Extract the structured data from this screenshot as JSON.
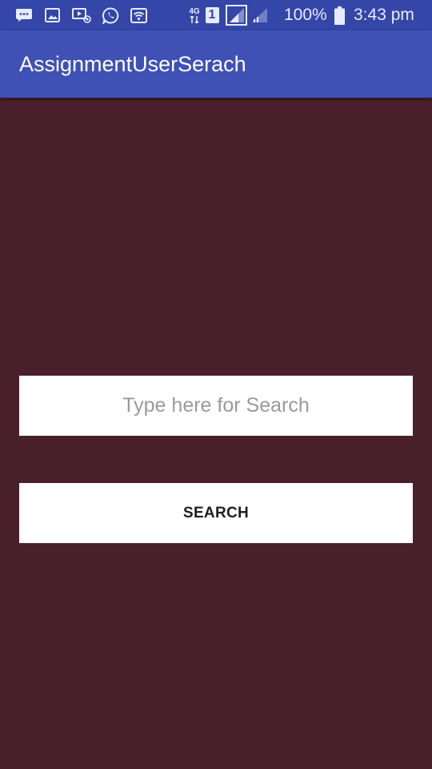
{
  "status_bar": {
    "network_type": "4G",
    "sim_slot": "1",
    "battery_percent": "100%",
    "time": "3:43 pm",
    "icons": [
      "messenger-icon",
      "gallery-icon",
      "screen-recorder-icon",
      "whatsapp-icon",
      "wifi-icon",
      "network-4g-icon",
      "sim1-icon",
      "signal-sim1-icon",
      "signal-sim2-icon",
      "battery-icon"
    ]
  },
  "app_bar": {
    "title": "AssignmentUserSerach",
    "color": "#3f51b5"
  },
  "search": {
    "placeholder": "Type here for Search",
    "value": ""
  },
  "search_button": {
    "label": "SEARCH"
  },
  "colors": {
    "status_bar": "#3446a7",
    "background": "#481f2b",
    "field": "#ffffff"
  }
}
